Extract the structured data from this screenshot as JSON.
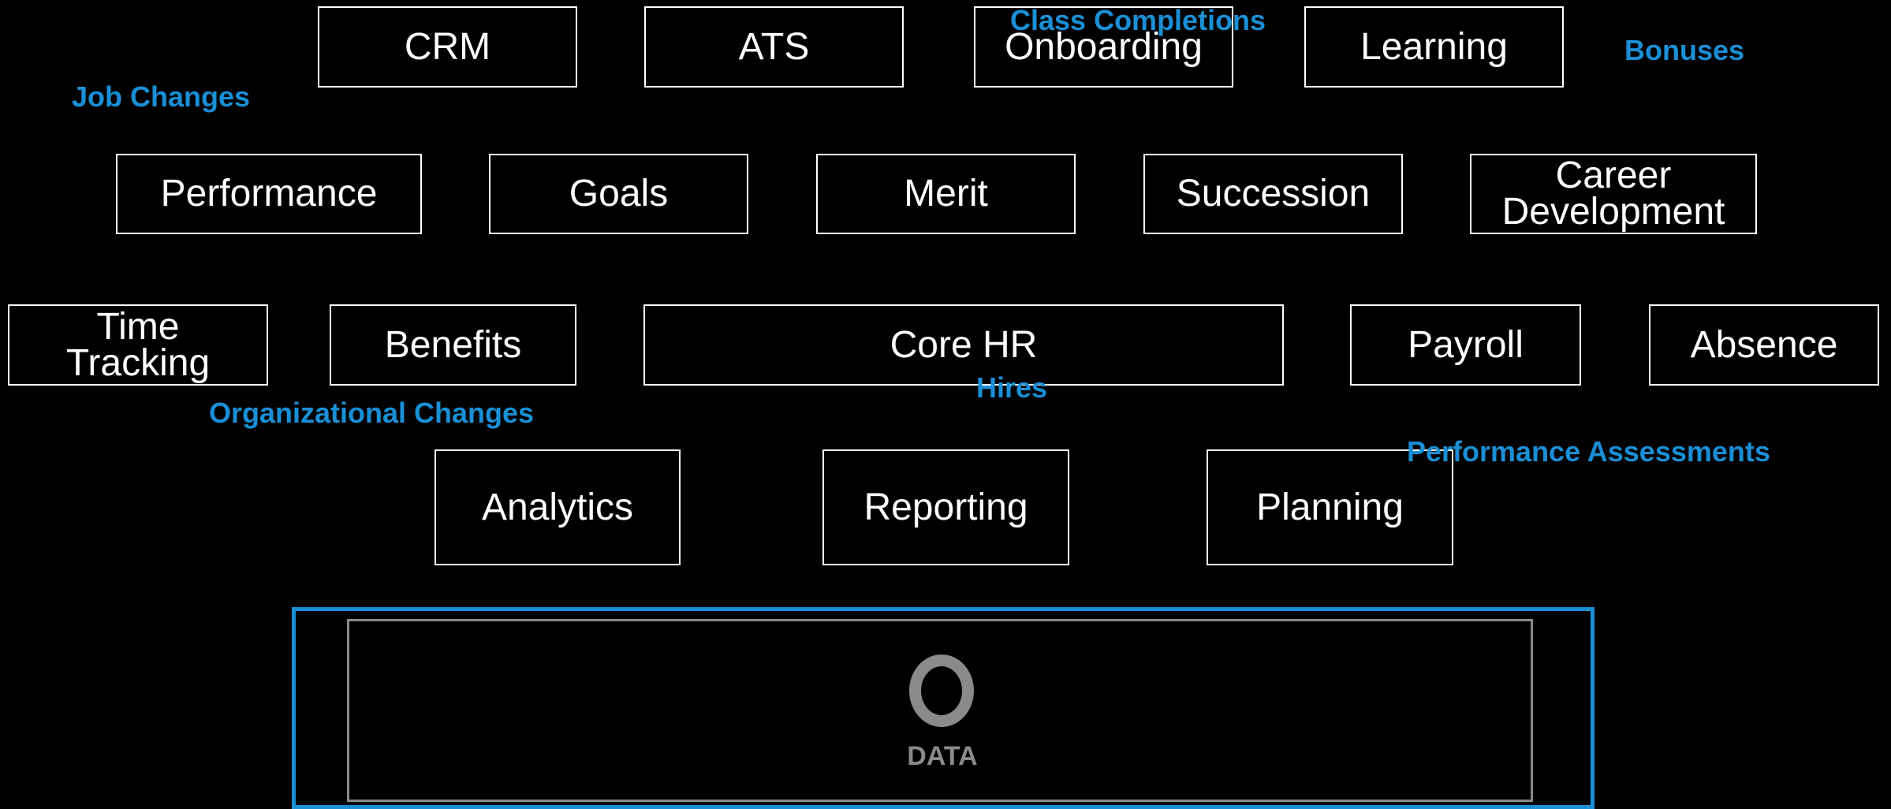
{
  "modules": {
    "crm": "CRM",
    "ats": "ATS",
    "onboarding": "Onboarding",
    "learning": "Learning",
    "performance": "Performance",
    "goals": "Goals",
    "merit": "Merit",
    "succession": "Succession",
    "career_development": [
      "Career",
      "Development"
    ],
    "time_tracking": [
      "Time",
      "Tracking"
    ],
    "benefits": "Benefits",
    "core_hr": "Core HR",
    "payroll": "Payroll",
    "absence": "Absence",
    "analytics": "Analytics",
    "reporting": "Reporting",
    "planning": "Planning"
  },
  "events": {
    "class_completions": "Class Completions",
    "bonuses": "Bonuses",
    "job_changes": "Job Changes",
    "hires": "Hires",
    "organizational_changes": "Organizational Changes",
    "performance_assessments": "Performance Assessments"
  },
  "data_layer": {
    "label": "DATA",
    "logo_icon": "oracle-o-logo-icon"
  },
  "colors": {
    "background": "#000000",
    "box_border": "#ffffff",
    "event_text": "#1a8fd6",
    "data_border": "#1a8fd6",
    "data_logo": "#8a8a8a"
  }
}
